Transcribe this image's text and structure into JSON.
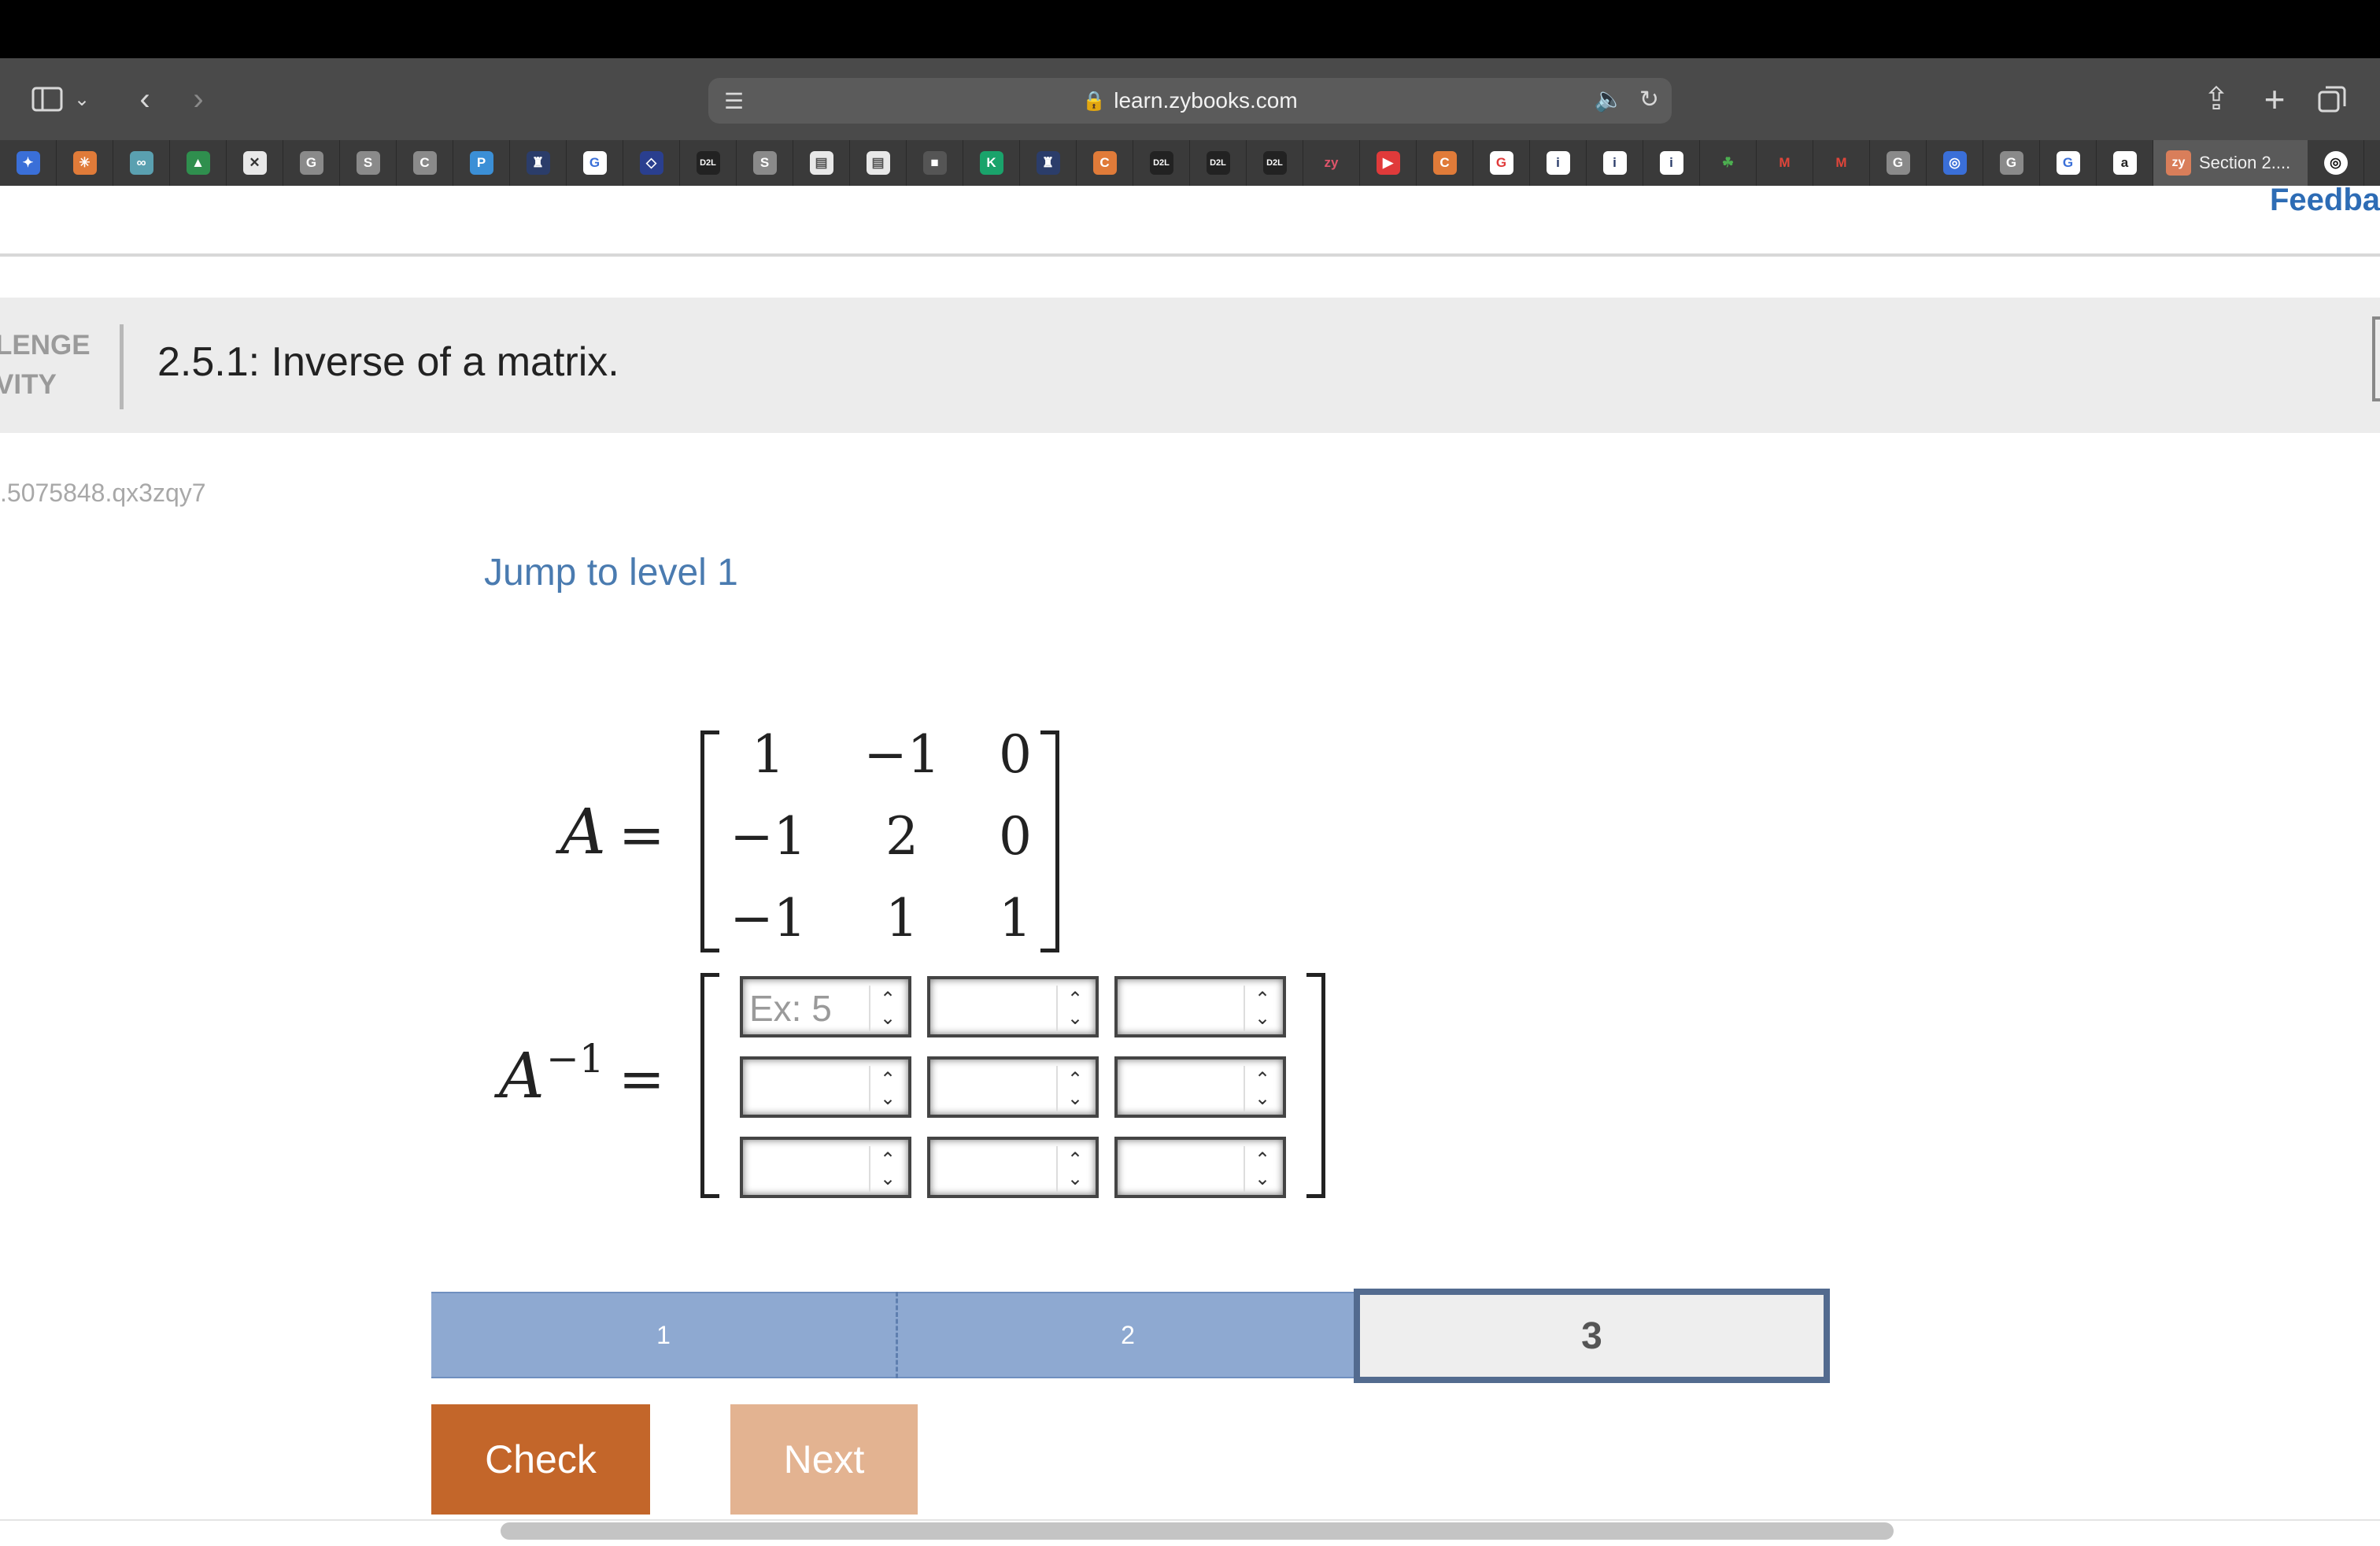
{
  "browser": {
    "url": "learn.zybooks.com",
    "active_tab_label": "Section 2....",
    "bookmark_icons": [
      "✦",
      "✳",
      "∞",
      "▲",
      "✕",
      "G",
      "S",
      "C",
      "P",
      "♜",
      "G",
      "◇",
      "D2L",
      "S",
      "▤",
      "▤",
      "■",
      "K",
      "♜",
      "C",
      "D2L",
      "D2L",
      "D2L",
      "zy",
      "▶",
      "C",
      "G",
      "i",
      "i",
      "i",
      "☘",
      "M",
      "M",
      "G",
      "◎",
      "G",
      "G",
      "a"
    ]
  },
  "page": {
    "feedback_link": "Feedba",
    "activity_label_line1": "LENGE",
    "activity_label_line2": "VITY",
    "activity_title": "2.5.1: Inverse of a matrix.",
    "activity_id": ".5075848.qx3zqy7",
    "jump_link": "Jump to level 1"
  },
  "matrix_a": {
    "label": "A",
    "equals": "=",
    "rows": [
      [
        "1",
        "−1",
        "0"
      ],
      [
        "−1",
        "2",
        "0"
      ],
      [
        "−1",
        "1",
        "1"
      ]
    ]
  },
  "matrix_inverse": {
    "label": "A",
    "superscript": "−1",
    "equals": "=",
    "placeholder": "Ex: 5",
    "cells": [
      [
        "",
        "",
        ""
      ],
      [
        "",
        "",
        ""
      ],
      [
        "",
        "",
        ""
      ]
    ]
  },
  "progress": {
    "levels": [
      "1",
      "2",
      "3"
    ],
    "completed": 2,
    "current": 3
  },
  "buttons": {
    "check": "Check",
    "next": "Next"
  },
  "colors": {
    "check_button": "#c3662a",
    "next_button": "#e3b391",
    "progress_done": "#8ea9d1",
    "progress_current_border": "#536b8f",
    "link": "#4a7bb0"
  }
}
